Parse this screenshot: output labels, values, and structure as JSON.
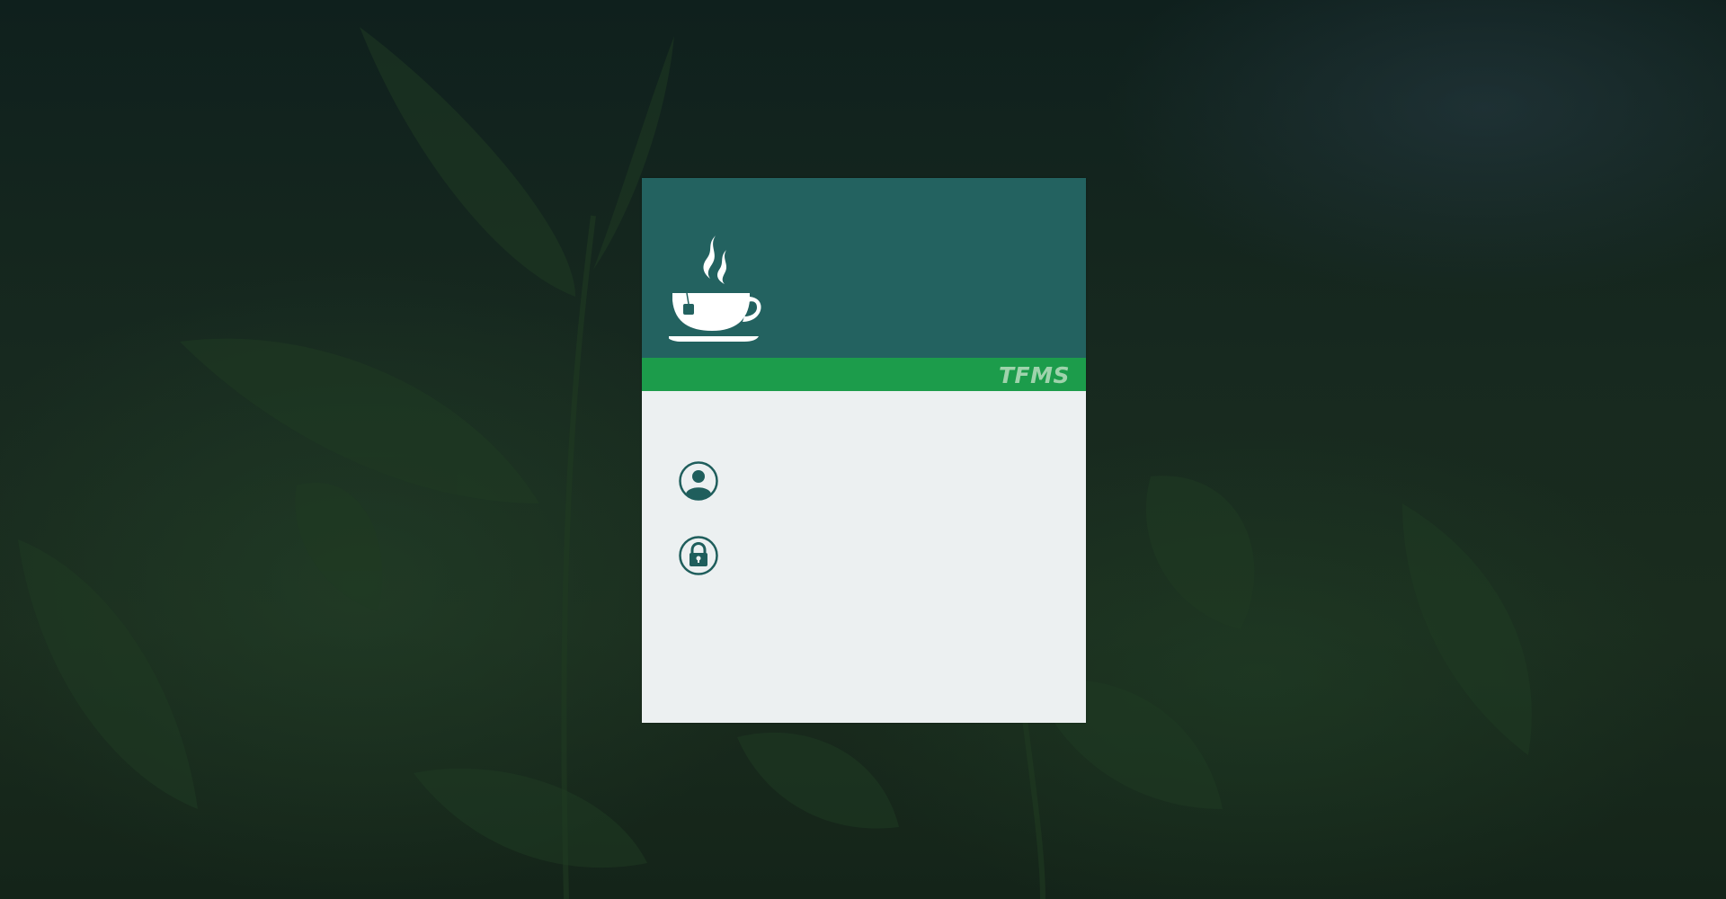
{
  "app": {
    "brand_name": "TFMS"
  },
  "login": {
    "username": {
      "icon": "user-circle-icon",
      "value": "",
      "placeholder": ""
    },
    "password": {
      "icon": "lock-circle-icon",
      "value": "",
      "placeholder": ""
    }
  },
  "theme": {
    "header_color": "#236260",
    "brand_bar_color": "#1c9c4b",
    "card_background": "#ecf0f1",
    "icon_color": "#1f5e5c"
  },
  "icons": {
    "logo": "tea-cup-icon"
  }
}
